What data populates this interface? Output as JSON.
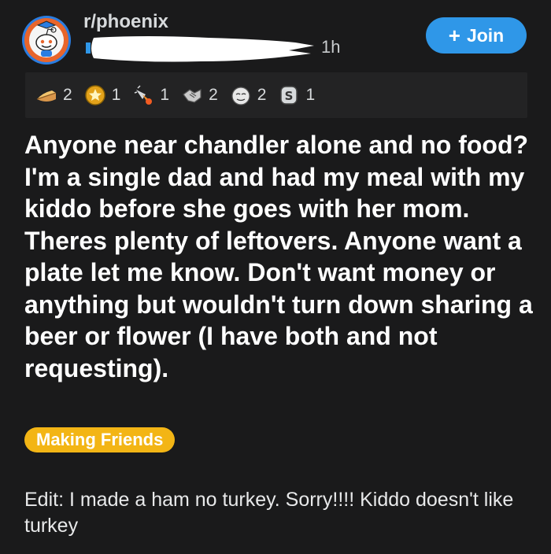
{
  "post": {
    "subreddit": "r/phoenix",
    "timestamp": "1h",
    "join_label": "Join",
    "title": "Anyone near chandler alone and no food? I'm a single dad and had my meal with my kiddo before she goes with her mom. Theres plenty of leftovers. Anyone want a plate let me know. Don't want money or anything but wouldn't turn down sharing a beer or flower (I have both and not requesting).",
    "flair": "Making Friends",
    "body": "Edit: I made a ham no turkey. Sorry!!!! Kiddo doesn't like turkey"
  },
  "awards": [
    {
      "icon": "pie-award-icon",
      "count": "2"
    },
    {
      "icon": "star-shield-award-icon",
      "count": "1"
    },
    {
      "icon": "rocket-award-icon",
      "count": "1"
    },
    {
      "icon": "handshake-award-icon",
      "count": "2"
    },
    {
      "icon": "face-award-icon",
      "count": "2"
    },
    {
      "icon": "coin-award-icon",
      "count": "1"
    }
  ],
  "colors": {
    "background": "#1a1a1b",
    "awards_bar": "#232324",
    "join_button": "#2f97e8",
    "flair": "#f3b515",
    "avatar": "#2a7de1"
  }
}
